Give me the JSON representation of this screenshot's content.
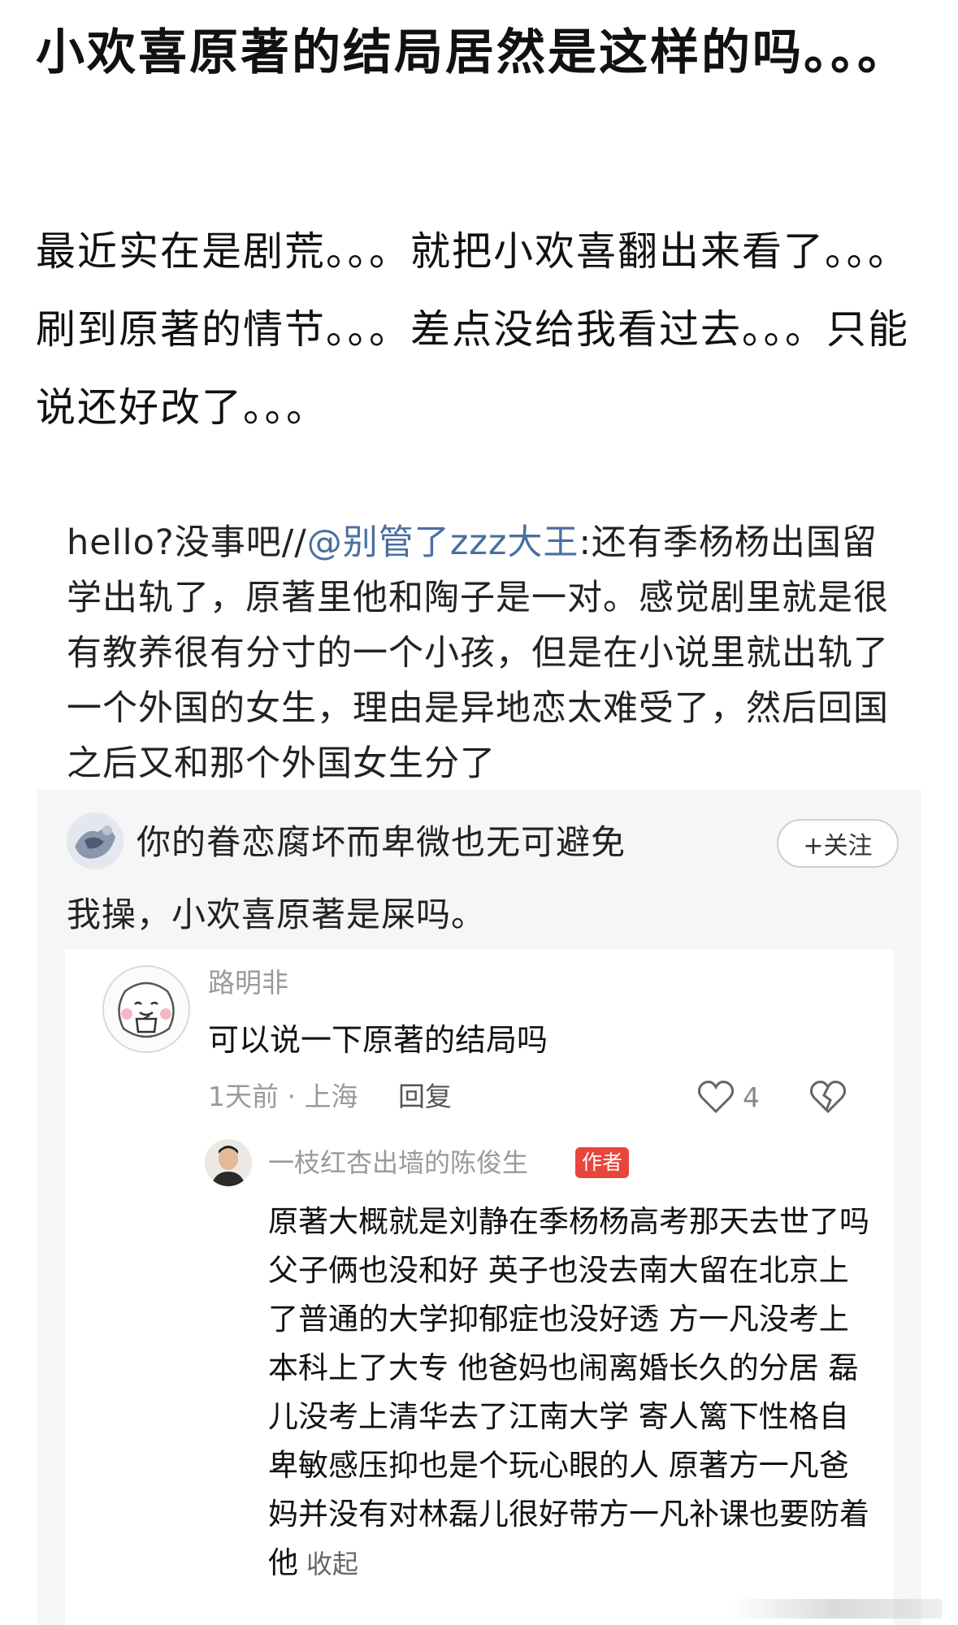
{
  "post": {
    "title": "小欢喜原著的结局居然是这样的吗。。。",
    "body": "最近实在是剧荒。。。就把小欢喜翻出来看了。。。刷到原著的情节。。。差点没给我看过去。。。只能说还好改了。。。"
  },
  "repost": {
    "prefix": "hello?没事吧//",
    "mention": "@别管了zzz大王",
    "text": ":还有季杨杨出国留学出轨了，原著里他和陶子是一对。感觉剧里就是很有教养很有分寸的一个小孩，但是在小说里就出轨了一个外国的女生，理由是异地恋太难受了，然后回国之后又和那个外国女生分了"
  },
  "comment": {
    "username": "你的眷恋腐坏而卑微也无可避免",
    "follow_label": "+关注",
    "text": "我操，小欢喜原著是屎吗。"
  },
  "reply": {
    "username": "路明非",
    "text": "可以说一下原著的结局吗",
    "meta": "1天前 · 上海",
    "reply_label": "回复",
    "like_count": "4"
  },
  "author_reply": {
    "username": "一枝红杏出墙的陈俊生",
    "badge": "作者",
    "text": "原著大概就是刘静在季杨杨高考那天去世了吗父子俩也没和好 英子也没去南大留在北京上了普通的大学抑郁症也没好透 方一凡没考上本科上了大专 他爸妈也闹离婚长久的分居 磊儿没考上清华去了江南大学 寄人篱下性格自卑敏感压抑也是个玩心眼的人 原著方一凡爸妈并没有对林磊儿很好带方一凡补课也要防着他",
    "collapse_label": "收起"
  },
  "icons": {
    "like": "heart-outline-icon",
    "dislike": "broken-heart-icon"
  },
  "colors": {
    "mention": "#4a6fa1",
    "badge": "#e8453c",
    "card_bg": "#f6f6f6"
  }
}
